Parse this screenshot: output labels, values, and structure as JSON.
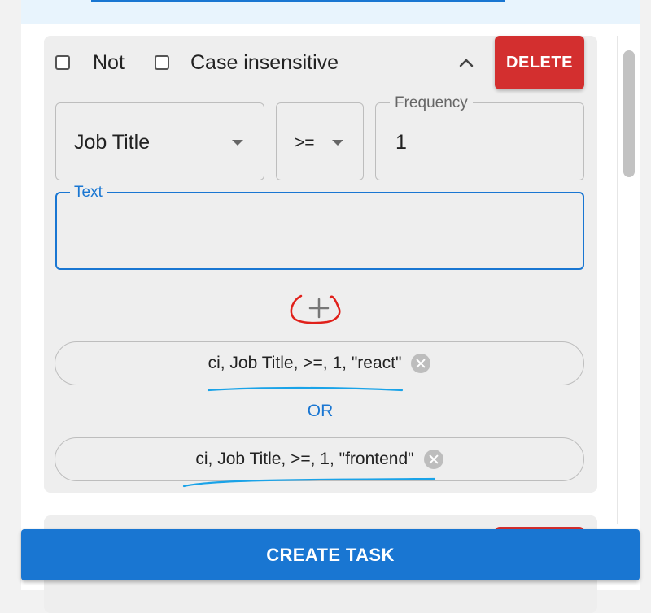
{
  "header": {
    "not_label": "Not",
    "case_insensitive_label": "Case insensitive",
    "delete_label": "DELETE"
  },
  "filters": {
    "field_value": "Job Title",
    "operator_value": ">=",
    "frequency_label": "Frequency",
    "frequency_value": "1",
    "text_label": "Text",
    "text_value": ""
  },
  "conditions": [
    {
      "label": "ci, Job Title, >=, 1, \"react\""
    },
    {
      "label": "ci, Job Title, >=, 1, \"frontend\""
    }
  ],
  "connector_label": "OR",
  "footer": {
    "create_task_label": "CREATE TASK"
  },
  "colors": {
    "primary": "#1976d2",
    "danger": "#d32f2f",
    "card_bg": "#eeeeee",
    "annotation_red": "#e0201a",
    "annotation_blue": "#1aa3e8"
  },
  "icons": {
    "collapse": "chevron-up-icon",
    "add": "plus-icon",
    "chip_delete": "cancel-circle-icon",
    "dropdown": "caret-down-icon"
  }
}
